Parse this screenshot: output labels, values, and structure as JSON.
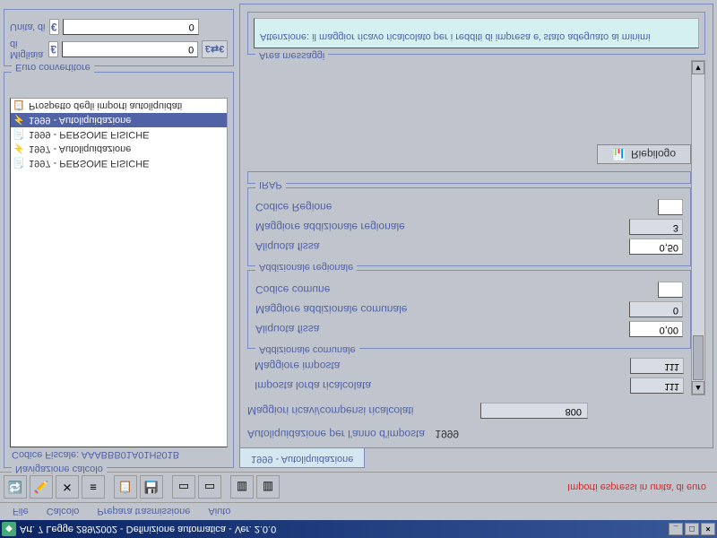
{
  "titlebar": {
    "text": "Art. 7 Legge 289/2002 - Definizione automatica - Ver. 2.0.0"
  },
  "menu": {
    "file": "File",
    "calcolo": "Calcolo",
    "prepara": "Prepara trasmissione",
    "aiuto": "Aiuto"
  },
  "toolbar": {
    "note": "Importi espressi in unita' di euro"
  },
  "nav": {
    "legend": "Navigazione calcolo",
    "cf_label": "Codice Fiscale:",
    "cf_value": "AAABBB01A01H501B",
    "items": [
      {
        "icon": "📄",
        "label": "1997 - PERSONE FISICHE"
      },
      {
        "icon": "⚡",
        "label": "1997 - Autoliquidazione"
      },
      {
        "icon": "📄",
        "label": "1999 - PERSONE FISICHE"
      },
      {
        "icon": "⚡",
        "label": "1999 - Autoliquidazione"
      }
    ],
    "prospetto": {
      "icon": "📋",
      "label": "Prospetto degli importi autoliquidati"
    }
  },
  "conv": {
    "legend": "Euro convertitore",
    "migliaia_label": "Migliaia di",
    "unita_label": "Unita' di",
    "migliaia_val": "0",
    "unita_val": "0",
    "btn": "£⇆€"
  },
  "tab": {
    "label": "1999 - Autoliquidazione"
  },
  "content": {
    "year_label": "Autoliquidazione per l'anno d'imposta",
    "year_val": "1999",
    "maggiori_label": "Maggiori ricavi/compensi ricalcolati",
    "maggiori_val": "800",
    "imposta_lorda_label": "Imposta lorda ricalcolata",
    "imposta_lorda_val": "111",
    "maggiore_imposta_label": "Maggiore imposta",
    "maggiore_imposta_val": "111"
  },
  "add_com": {
    "legend": "Addizionale comunale",
    "aliquota_label": "Aliquota fissa",
    "aliquota_val": "0,00",
    "maggiore_label": "Maggiore addizionale comunale",
    "maggiore_val": "0",
    "codice_label": "Codice comune",
    "codice_val": ""
  },
  "add_reg": {
    "legend": "Addizionale regionale",
    "aliquota_label": "Aliquota fissa",
    "aliquota_val": "0,50",
    "maggiore_label": "Maggiore addizionale regionale",
    "maggiore_val": "3",
    "codice_label": "Codice Regione",
    "codice_val": ""
  },
  "irap": {
    "legend": "IRAP"
  },
  "riepilogo": {
    "label": "Riepilogo"
  },
  "msg": {
    "legend": "Area messaggi",
    "text": "Attenzione: il maggior ricavo ricalcolato per i redditi di impresa e' stato adeguato ai minimi"
  }
}
